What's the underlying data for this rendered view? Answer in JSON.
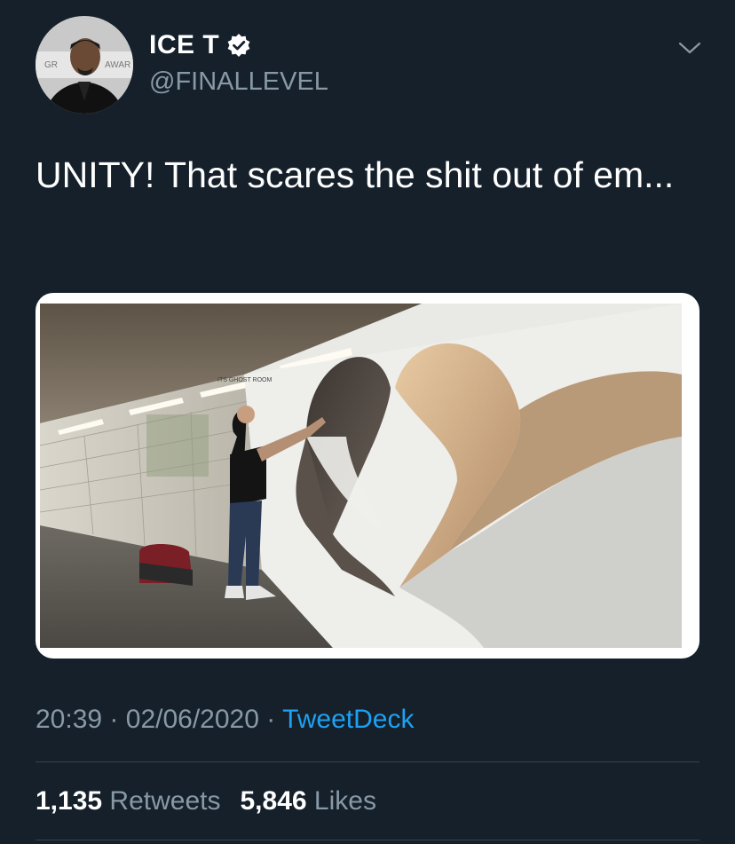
{
  "user": {
    "display_name": "ICE T",
    "handle": "@FINALLEVEL",
    "verified": true,
    "avatar_backdrop_text_left": "GR",
    "avatar_backdrop_text_right": "AWAR"
  },
  "tweet": {
    "text": "UNITY! That scares the shit out of em...",
    "time": "20:39",
    "date": "02/06/2020",
    "separator": "·",
    "source": "TweetDeck"
  },
  "media": {
    "wall_tag": "ITS GHOST ROOM"
  },
  "stats": {
    "retweets_count": "1,135",
    "retweets_label": "Retweets",
    "likes_count": "5,846",
    "likes_label": "Likes"
  },
  "icons": {
    "verified": "verified-check-icon",
    "caret": "chevron-down-icon"
  },
  "colors": {
    "background": "#15202b",
    "text_primary": "#ffffff",
    "text_secondary": "#8899a6",
    "link": "#1da1f2",
    "divider": "#38444d"
  }
}
